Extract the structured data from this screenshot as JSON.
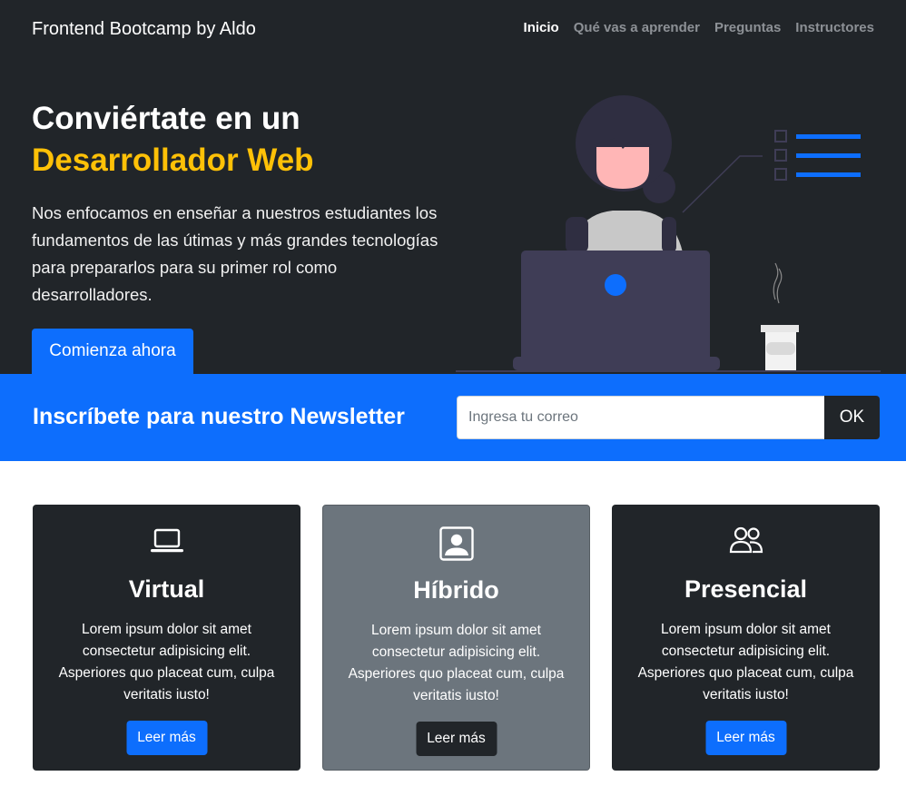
{
  "navbar": {
    "brand": "Frontend Bootcamp by Aldo",
    "links": [
      "Inicio",
      "Qué vas a aprender",
      "Preguntas",
      "Instructores"
    ]
  },
  "hero": {
    "title_line1": "Conviértate en un",
    "title_highlight": "Desarrollador Web",
    "text": "Nos enfocamos en enseñar a nuestros estudiantes los fundamentos de las útimas y más grandes tecnologías para prepararlos para su primer rol como desarrolladores.",
    "cta_label": "Comienza ahora"
  },
  "newsletter": {
    "title": "Inscríbete para nuestro Newsletter",
    "input_value": "",
    "input_placeholder": "Ingresa tu correo",
    "button_label": "OK"
  },
  "cards": [
    {
      "icon": "laptop-icon",
      "title": "Virtual",
      "text": "Lorem ipsum dolor sit amet consectetur adipisicing elit. Asperiores quo placeat cum, culpa veritatis iusto!",
      "button_label": "Leer más"
    },
    {
      "icon": "person-square-icon",
      "title": "Híbrido",
      "text": "Lorem ipsum dolor sit amet consectetur adipisicing elit. Asperiores quo placeat cum, culpa veritatis iusto!",
      "button_label": "Leer más"
    },
    {
      "icon": "people-icon",
      "title": "Presencial",
      "text": "Lorem ipsum dolor sit amet consectetur adipisicing elit. Asperiores quo placeat cum, culpa veritatis iusto!",
      "button_label": "Leer más"
    }
  ],
  "colors": {
    "dark": "#212529",
    "primary": "#0d6efd",
    "highlight": "#ffc107",
    "secondary": "#6c757d"
  }
}
